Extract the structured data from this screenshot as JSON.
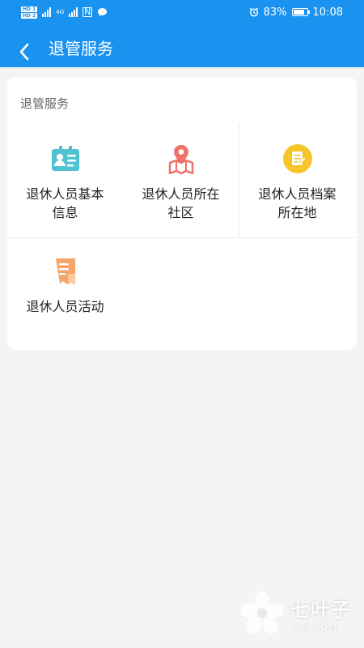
{
  "status_bar": {
    "network": "4G",
    "battery_level": "83%",
    "time": "10:08",
    "battery_fraction": 0.83
  },
  "app_bar": {
    "title": "退管服务",
    "back_icon": "chevron-left-icon"
  },
  "card": {
    "title": "退管服务",
    "items": [
      {
        "label": "退休人员基本信息",
        "icon": "id-card-icon",
        "color": "#4fc3cf"
      },
      {
        "label": "退休人员所在社区",
        "icon": "map-pin-icon",
        "color": "#f0706a"
      },
      {
        "label": "退休人员档案所在地",
        "icon": "file-edit-icon",
        "color": "#f5c52a"
      },
      {
        "label": "退休人员活动",
        "icon": "document-bookmark-icon",
        "color": "#f5a46a"
      }
    ]
  },
  "watermark": {
    "name": "七叶子",
    "domain": "7YZ.COM"
  },
  "colors": {
    "primary": "#1a93f0",
    "background": "#f4f4f4"
  }
}
